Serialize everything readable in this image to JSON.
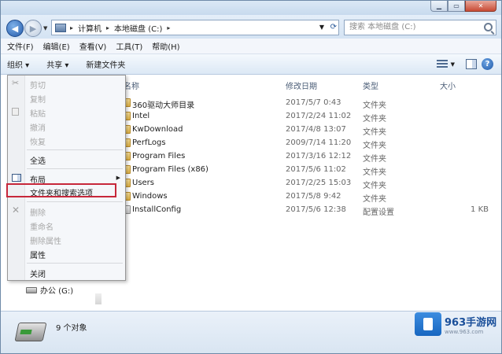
{
  "address": {
    "crumbs": [
      "计算机",
      "本地磁盘 (C:)"
    ]
  },
  "search": {
    "placeholder": "搜索 本地磁盘 (C:)"
  },
  "menubar": [
    "文件(F)",
    "编辑(E)",
    "查看(V)",
    "工具(T)",
    "帮助(H)"
  ],
  "toolbar": {
    "organize": "组织 ▾",
    "share": "共享 ▾",
    "new_folder": "新建文件夹",
    "help": "?"
  },
  "columns": {
    "name": "名称",
    "date": "修改日期",
    "type": "类型",
    "size": "大小"
  },
  "files": [
    {
      "name": "360驱动大师目录",
      "date": "2017/5/7 0:43",
      "type": "文件夹",
      "size": "",
      "icon": "folder-icon"
    },
    {
      "name": "Intel",
      "date": "2017/2/24 11:02",
      "type": "文件夹",
      "size": "",
      "icon": "folder-icon"
    },
    {
      "name": "KwDownload",
      "date": "2017/4/8 13:07",
      "type": "文件夹",
      "size": "",
      "icon": "folder-icon"
    },
    {
      "name": "PerfLogs",
      "date": "2009/7/14 11:20",
      "type": "文件夹",
      "size": "",
      "icon": "folder-icon"
    },
    {
      "name": "Program Files",
      "date": "2017/3/16 12:12",
      "type": "文件夹",
      "size": "",
      "icon": "folder-icon"
    },
    {
      "name": "Program Files (x86)",
      "date": "2017/5/6 11:02",
      "type": "文件夹",
      "size": "",
      "icon": "folder-icon"
    },
    {
      "name": "Users",
      "date": "2017/2/25 15:03",
      "type": "文件夹",
      "size": "",
      "icon": "folder-icon"
    },
    {
      "name": "Windows",
      "date": "2017/5/8 9:42",
      "type": "文件夹",
      "size": "",
      "icon": "folder-icon"
    },
    {
      "name": "InstallConfig",
      "date": "2017/5/6 12:38",
      "type": "配置设置",
      "size": "1 KB",
      "icon": "config-file-icon"
    }
  ],
  "context_menu": {
    "cut": "剪切",
    "copy": "复制",
    "paste": "粘贴",
    "undo": "撤消",
    "redo": "恢复",
    "select_all": "全选",
    "layout": "布局",
    "folder_options": "文件夹和搜索选项",
    "delete": "删除",
    "rename": "重命名",
    "remove_props": "删除属性",
    "properties": "属性",
    "close": "关闭"
  },
  "nav": {
    "drive": "办公 (G:)"
  },
  "status": {
    "count": "9 个对象"
  },
  "watermark": {
    "brand": "963手游网",
    "url": "www.963.com"
  },
  "colors": {
    "highlight": "#c7273a",
    "accent": "#245aa9"
  }
}
